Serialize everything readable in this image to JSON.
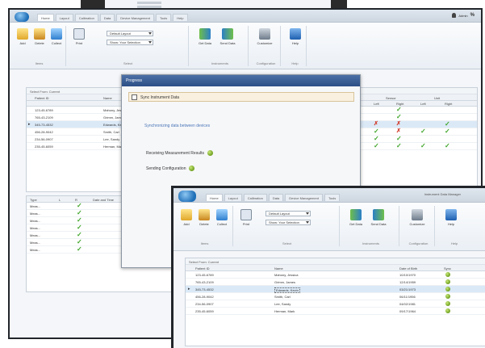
{
  "window_main": {
    "tabs": [
      "Home",
      "Layout",
      "Calibration",
      "Data",
      "Device Management",
      "Tools",
      "Help"
    ],
    "active_tab": "Home",
    "user_label": "Admin",
    "ribbon": {
      "groups": [
        {
          "label": "Items",
          "buttons": [
            "Add",
            "Delete",
            "Collect"
          ]
        },
        {
          "label": "Select",
          "buttons": [
            "Print"
          ]
        },
        {
          "label": "Instruments",
          "buttons": [
            "Get Data",
            "Send Data"
          ]
        },
        {
          "label": "Configuration",
          "buttons": [
            "Customize"
          ]
        },
        {
          "label": "Help",
          "buttons": [
            "Help"
          ]
        }
      ],
      "dropdowns": [
        "Default Layout",
        "Show: Your Selection"
      ]
    },
    "grid": {
      "title": "Select From: Current",
      "columns": [
        "Patient ID",
        "Name"
      ],
      "right_columns": {
        "group1": "Sensor",
        "group2": "Unit",
        "sub": [
          "Left",
          "Right",
          "Left",
          "Right"
        ]
      },
      "rows": [
        {
          "id": "123-45-6789",
          "name": "Mahony, Jessica",
          "sel": false,
          "checks": [
            "",
            "check",
            "",
            ""
          ]
        },
        {
          "id": "765-43-2109",
          "name": "Grimm, James",
          "sel": false,
          "checks": [
            "",
            "check",
            "",
            ""
          ]
        },
        {
          "id": "345-73-4532",
          "name": "Edwards, Kevin",
          "sel": true,
          "checks": [
            "cross",
            "cross",
            "",
            "check"
          ]
        },
        {
          "id": "456-28-9042",
          "name": "Smith, Carl",
          "sel": false,
          "checks": [
            "check",
            "cross",
            "check",
            "check"
          ]
        },
        {
          "id": "234-56-0907",
          "name": "Lee, Sandy",
          "sel": false,
          "checks": [
            "check",
            "check",
            "",
            ""
          ]
        },
        {
          "id": "235-45-6059",
          "name": "Herman, Mark",
          "sel": false,
          "checks": [
            "check",
            "check",
            "check",
            "check"
          ]
        }
      ]
    },
    "lower_grid": {
      "columns": [
        "Type",
        "L",
        "R",
        "Date and Time"
      ],
      "rows": [
        {
          "type": "Meas...",
          "checked": true
        },
        {
          "type": "Meas...",
          "checked": true
        },
        {
          "type": "Meas...",
          "checked": true
        },
        {
          "type": "Meas...",
          "checked": true
        },
        {
          "type": "Meas...",
          "checked": true
        },
        {
          "type": "Meas...",
          "checked": true
        },
        {
          "type": "Meas...",
          "checked": true
        }
      ]
    }
  },
  "dialog": {
    "title": "Progress",
    "checkbox_label": "Sync Instrument Data",
    "subtitle": "Synchronizing data between devices",
    "steps": [
      "Receiving Measurement Results",
      "Sending Configuration"
    ]
  },
  "window_front": {
    "caption": "Instrument Data Manager",
    "tabs": [
      "Home",
      "Layout",
      "Calibration",
      "Data",
      "Device Management",
      "Tools"
    ],
    "ribbon": {
      "groups": [
        {
          "label": "Items",
          "buttons": [
            "Add",
            "Delete",
            "Collect"
          ]
        },
        {
          "label": "Select",
          "buttons": [
            "Print"
          ]
        },
        {
          "label": "Instruments",
          "buttons": [
            "Get Data",
            "Send Data"
          ]
        },
        {
          "label": "Configuration",
          "buttons": [
            "Customize"
          ]
        },
        {
          "label": "Help",
          "buttons": [
            "Help"
          ]
        }
      ],
      "dropdowns": [
        "Default Layout",
        "Show: Your Selection"
      ]
    },
    "grid": {
      "title": "Select From: Current",
      "columns": [
        "Patient ID",
        "Name",
        "Date of Birth",
        "Sync"
      ],
      "rows": [
        {
          "id": "123-45-6789",
          "name": "Mahony, Jessica",
          "dob": "10/10/1970",
          "sel": false
        },
        {
          "id": "765-43-2109",
          "name": "Grimm, James",
          "dob": "12/14/1959",
          "sel": false
        },
        {
          "id": "345-73-4532",
          "name": "Edwards, Kevin",
          "dob": "03/21/1973",
          "sel": true
        },
        {
          "id": "456-28-9042",
          "name": "Smith, Carl",
          "dob": "06/11/1956",
          "sel": false
        },
        {
          "id": "234-56-0907",
          "name": "Lee, Sandy",
          "dob": "04/02/1981",
          "sel": false
        },
        {
          "id": "235-45-6059",
          "name": "Herman, Mark",
          "dob": "09/17/1964",
          "sel": false
        }
      ]
    }
  },
  "colors": {
    "frame": "#22262b",
    "dialog_title": "#2d4f86",
    "check": "#3fa52a",
    "cross": "#d23b2b",
    "selection": "#dbe9f7"
  }
}
